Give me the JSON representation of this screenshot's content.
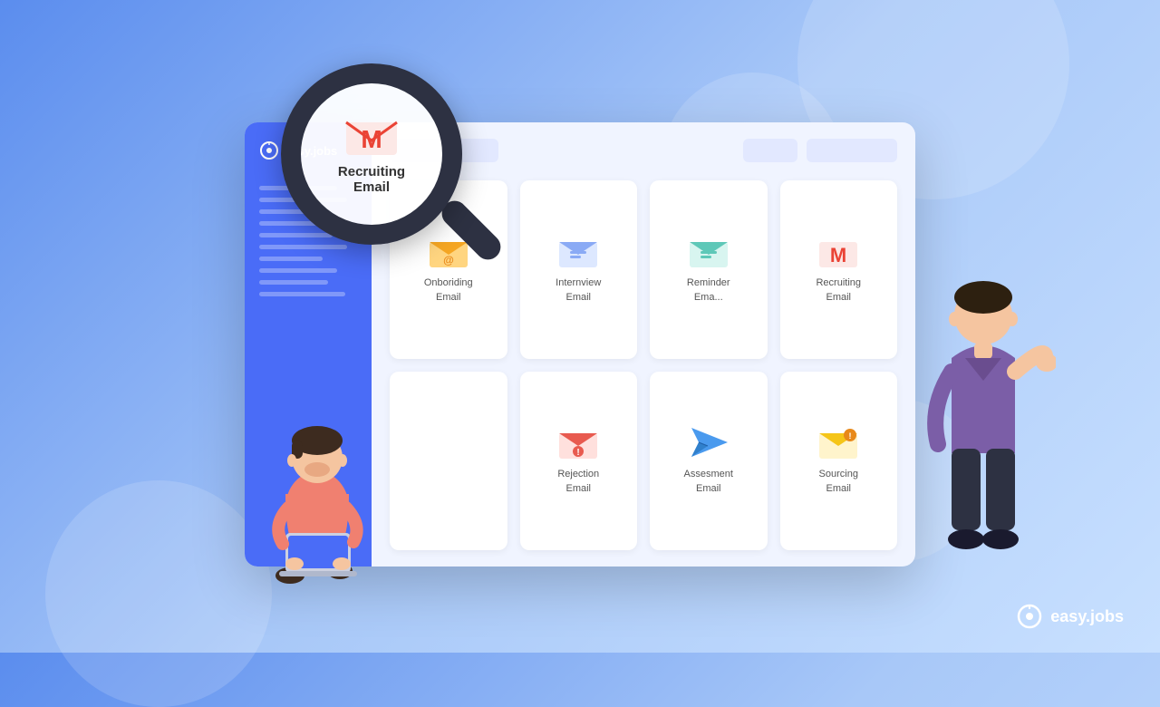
{
  "background": {
    "gradient_start": "#5b8dee",
    "gradient_end": "#c8e0ff"
  },
  "logo": {
    "text": "easy.jobs"
  },
  "sidebar": {
    "logo_text": "easy.jobs",
    "lines_count": 10
  },
  "topbar": {
    "search_placeholder": "",
    "button1_label": "",
    "button2_label": ""
  },
  "email_cards": [
    {
      "id": "onboarding",
      "label": "Onboriding\nEmail",
      "icon_type": "orange-envelope"
    },
    {
      "id": "interview",
      "label": "Internview\nEmail",
      "icon_type": "blue-envelope"
    },
    {
      "id": "reminder",
      "label": "Reminder\nEma...",
      "icon_type": "teal-envelope"
    },
    {
      "id": "recruiting",
      "label": "Recruiting\nEmail",
      "icon_type": "gmail",
      "magnified": true
    },
    {
      "id": "empty1",
      "label": "",
      "icon_type": "none"
    },
    {
      "id": "rejection",
      "label": "Rejection\nEmail",
      "icon_type": "red-envelope"
    },
    {
      "id": "assessment",
      "label": "Assesment\nEmail",
      "icon_type": "paper-plane"
    },
    {
      "id": "sourcing",
      "label": "Sourcing\nEmail",
      "icon_type": "yellow-envelope"
    }
  ],
  "magnified_card": {
    "label": "Recruiting\nEmail"
  },
  "bottom_logo": {
    "text": "easy.jobs"
  }
}
